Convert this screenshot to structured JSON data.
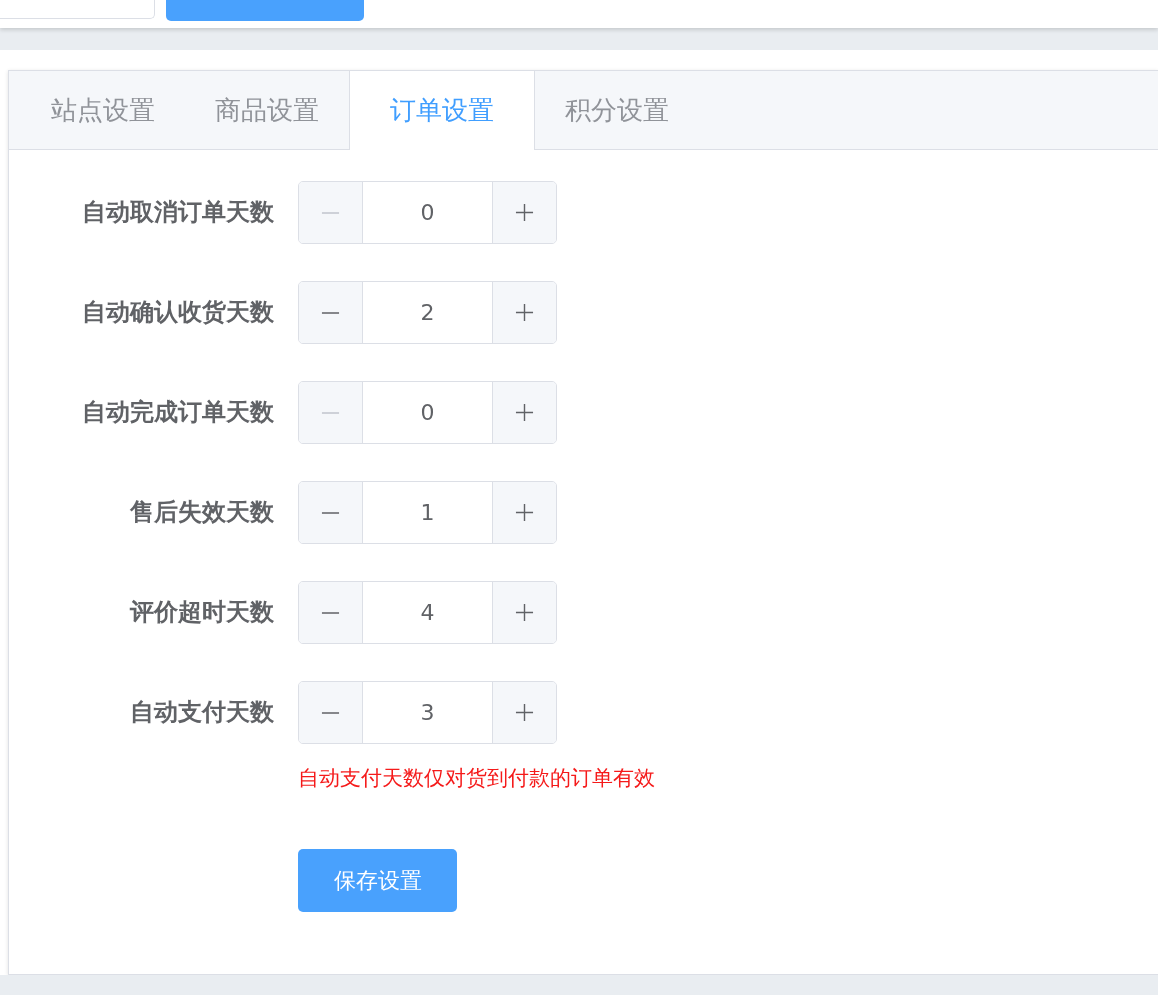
{
  "tabs": [
    {
      "label": "站点设置",
      "selected": false
    },
    {
      "label": "商品设置",
      "selected": false
    },
    {
      "label": "订单设置",
      "selected": true
    },
    {
      "label": "积分设置",
      "selected": false
    }
  ],
  "fields": [
    {
      "label": "自动取消订单天数",
      "value": "0",
      "minus_disabled": true
    },
    {
      "label": "自动确认收货天数",
      "value": "2",
      "minus_disabled": false
    },
    {
      "label": "自动完成订单天数",
      "value": "0",
      "minus_disabled": true
    },
    {
      "label": "售后失效天数",
      "value": "1",
      "minus_disabled": false
    },
    {
      "label": "评价超时天数",
      "value": "4",
      "minus_disabled": false
    },
    {
      "label": "自动支付天数",
      "value": "3",
      "minus_disabled": false,
      "hint": "自动支付天数仅对货到付款的订单有效"
    }
  ],
  "save_button": "保存设置"
}
